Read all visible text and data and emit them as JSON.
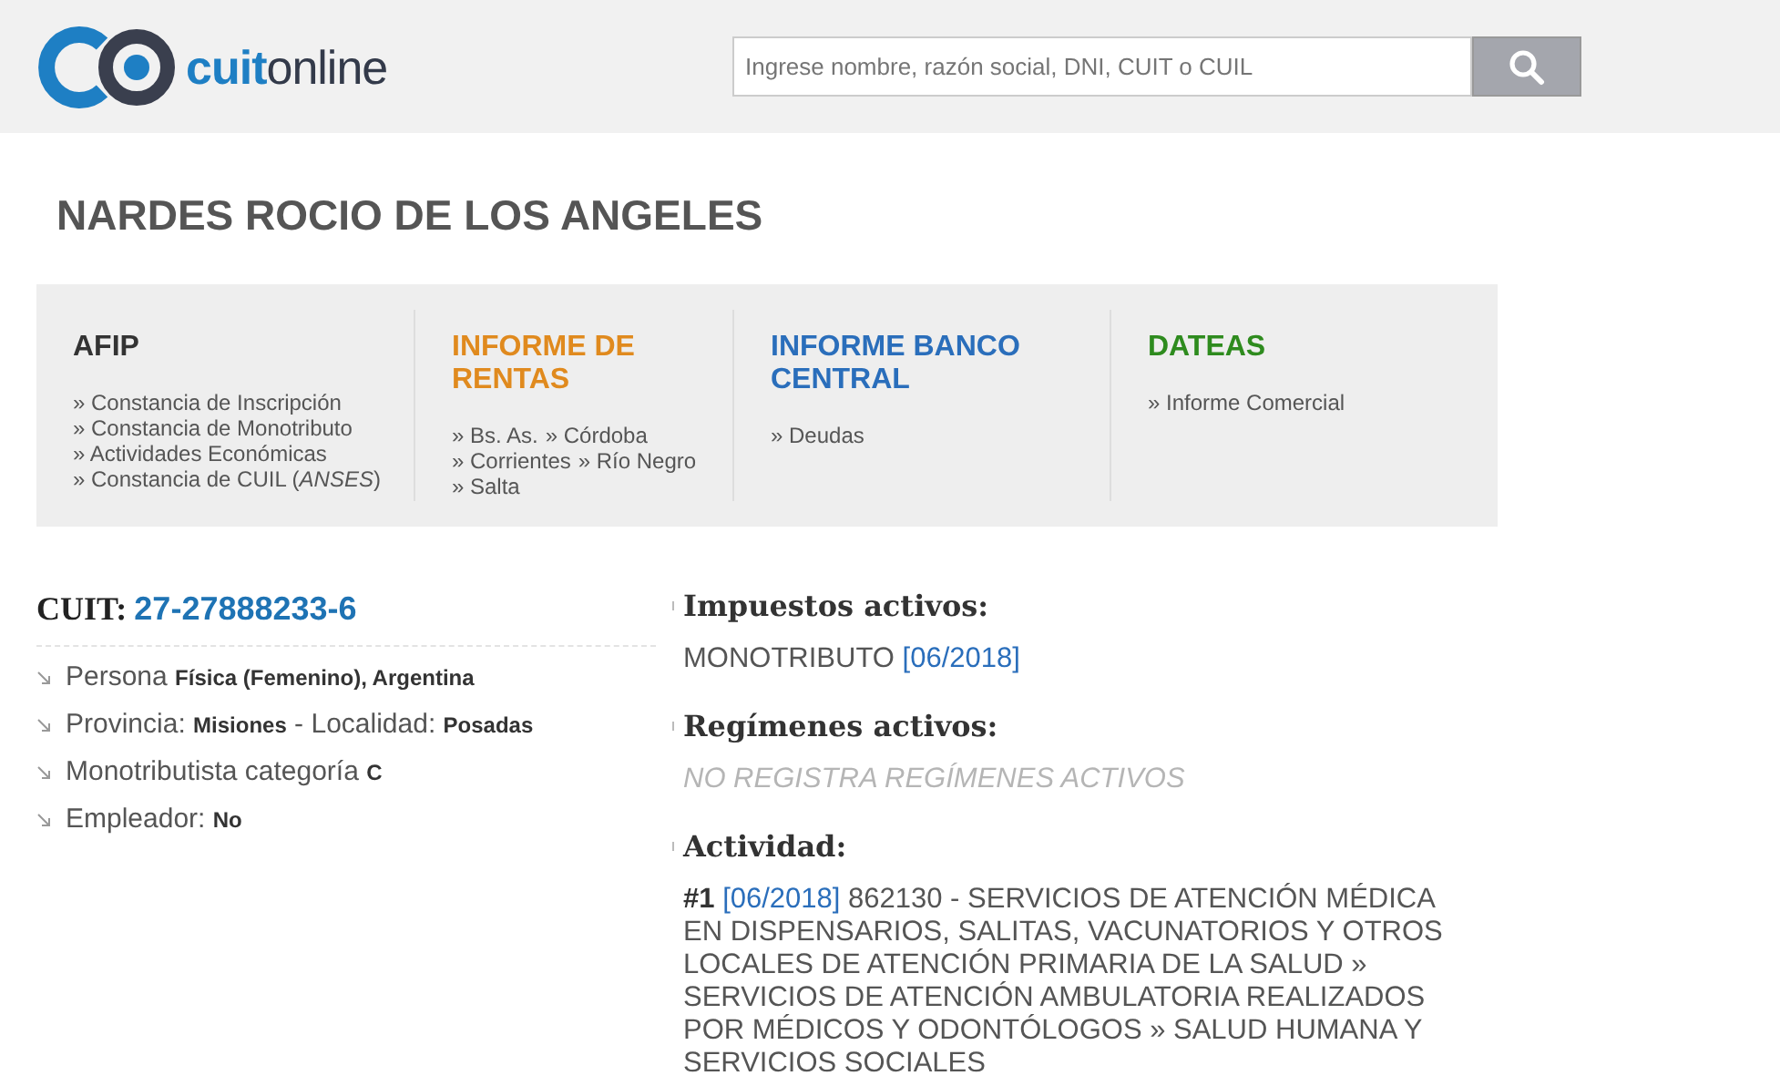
{
  "logo": {
    "bold": "cuit",
    "light": "online"
  },
  "search": {
    "placeholder": "Ingrese nombre, razón social, DNI, CUIT o CUIL"
  },
  "title": "NARDES ROCIO DE LOS ANGELES",
  "report_columns": [
    {
      "title": "AFIP",
      "color": "#333333",
      "lines": [
        [
          "» Constancia de Inscripción"
        ],
        [
          "» Constancia de Monotributo"
        ],
        [
          "» Actividades Económicas"
        ],
        [
          "» Constancia de CUIL (*ANSES*)"
        ]
      ]
    },
    {
      "title": "INFORME DE RENTAS",
      "color": "#e08a1e",
      "lines": [
        [
          "» Bs. As.",
          "» Córdoba"
        ],
        [
          "» Corrientes",
          "» Río Negro"
        ],
        [
          "» Salta"
        ]
      ]
    },
    {
      "title": "INFORME BANCO CENTRAL",
      "color": "#2a6ebb",
      "lines": [
        [
          "» Deudas"
        ]
      ]
    },
    {
      "title": "DATEAS",
      "color": "#2e8b1e",
      "lines": [
        [
          "» Informe Comercial"
        ]
      ]
    }
  ],
  "cuit": {
    "label": "CUIT:",
    "value": "27-27888233-6"
  },
  "facts": [
    "Persona **Física (Femenino), Argentina**",
    "Provincia: **Misiones** - Localidad: **Posadas**",
    "Monotributista categoría **C**",
    "Empleador: **No**"
  ],
  "sections": [
    {
      "heading": "Impuestos activos:",
      "kind": "tax",
      "text": "MONOTRIBUTO",
      "date": "[06/2018]"
    },
    {
      "heading": "Regímenes activos:",
      "kind": "empty",
      "text": "NO REGISTRA REGÍMENES ACTIVOS"
    },
    {
      "heading": "Actividad:",
      "kind": "activity",
      "number": "#1",
      "date": "[06/2018]",
      "text": "862130 - SERVICIOS DE ATENCIÓN MÉDICA EN DISPENSARIOS, SALITAS, VACUNATORIOS Y OTROS LOCALES DE ATENCIÓN PRIMARIA DE LA SALUD » SERVICIOS DE ATENCIÓN AMBULATORIA REALIZADOS POR MÉDICOS Y ODONTÓLOGOS » SALUD HUMANA Y SERVICIOS SOCIALES"
    }
  ]
}
